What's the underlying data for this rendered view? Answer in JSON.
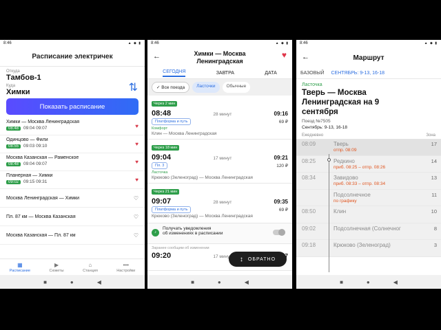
{
  "screen1": {
    "status_time": "8:46",
    "title": "Расписание электричек",
    "from_label": "Откуда",
    "from_value": "Тамбов-1",
    "to_label": "Куда",
    "to_value": "Химки",
    "show_button": "Показать расписание",
    "fav_routes": [
      {
        "title": "Химки — Москва Ленинградская",
        "badge": "08:48",
        "times": "09:04  09:07"
      },
      {
        "title": "Одинцово — Фили",
        "badge": "08:55",
        "times": "09:03  09:10"
      },
      {
        "title": "Москва Казанская — Раменское",
        "badge": "08:48",
        "times": "09:04  09:07"
      },
      {
        "title": "Планерная — Химки",
        "badge": "09:02",
        "times": "09:15  09:31"
      }
    ],
    "plain_routes": [
      "Москва Ленинградская — Химки",
      "Пл. 87 км — Москва Казанская",
      "Москва Казанская — Пл. 87 км"
    ],
    "tabs": [
      "Расписание",
      "Сюжеты",
      "Станция",
      "Настройки"
    ]
  },
  "screen2": {
    "status_time": "8:46",
    "title_line1": "Химки — Москва",
    "title_line2": "Ленинградская",
    "tabs": [
      "СЕГОДНЯ",
      "ЗАВТРА",
      "ДАТА"
    ],
    "chips": [
      "Все поезда",
      "Ласточки",
      "Обычные"
    ],
    "trains": [
      {
        "badge": "Через 2 мин",
        "dep": "08:48",
        "duration": "28 минут",
        "arr": "09:16",
        "platform": "Платформа и путь",
        "price": "69 ₽",
        "type": "Комфорт",
        "route": "Клин — Москва Ленинградская"
      },
      {
        "badge": "Через 18 мин",
        "dep": "09:04",
        "duration": "17 минут",
        "arr": "09:21",
        "platform": "Пл. 3",
        "price": "120 ₽",
        "type": "Ласточка",
        "route": "Крюково (Зеленоград) — Москва Ленинградская"
      },
      {
        "badge": "Через 21 мин",
        "dep": "09:07",
        "duration": "28 минут",
        "arr": "09:35",
        "platform": "Платформа и путь",
        "price": "69 ₽",
        "type": "",
        "route": "Крюково (Зеленоград) — Москва Ленинградская"
      }
    ],
    "notify_line1": "Получать уведомления",
    "notify_line2": "об изменениях в расписании",
    "notify_sub": "Заранее сообщим об изменении",
    "last_train": {
      "dep": "09:20",
      "duration": "17 минут",
      "arr": "09:37"
    },
    "back_button": "ОБРАТНО"
  },
  "screen3": {
    "status_time": "8:46",
    "title": "Маршрут",
    "tabs": [
      "БАЗОВЫЙ",
      "СЕНТЯБРЬ: 9-13, 16-18"
    ],
    "type": "Ласточка",
    "route_line1": "Тверь — Москва",
    "route_line2": "Ленинградская на 9",
    "route_line3": "сентября",
    "train_no": "Поезд №7505",
    "schedule": "Сентябрь: 9-13, 16-18",
    "daily_label": "Ежедневно",
    "zone_label": "Зона",
    "stops": [
      {
        "time": "08:09",
        "name": "Тверь",
        "delay": "отпр. 08:09",
        "zone": "17"
      },
      {
        "time": "08:25",
        "name": "Редкино",
        "delay": "приб. 08:25 – отпр. 08:26",
        "zone": "14"
      },
      {
        "time": "08:34",
        "name": "Завидово",
        "delay": "приб. 08:33 – отпр. 08:34",
        "zone": "13"
      },
      {
        "time": "",
        "name": "Подсолнечное",
        "delay": "по графику",
        "zone": "11"
      },
      {
        "time": "08:50",
        "name": "Клин",
        "delay": "",
        "zone": "10"
      },
      {
        "time": "09:02",
        "name": "Подсолнечная (Солнечног",
        "delay": "",
        "zone": "8"
      },
      {
        "time": "09:18",
        "name": "Крюково (Зеленоград)",
        "delay": "",
        "zone": "3"
      }
    ]
  },
  "colors": {
    "accent": "#2a6de0",
    "green": "#2e9e4a",
    "heart": "#e0364a",
    "delay": "#e0541e"
  }
}
